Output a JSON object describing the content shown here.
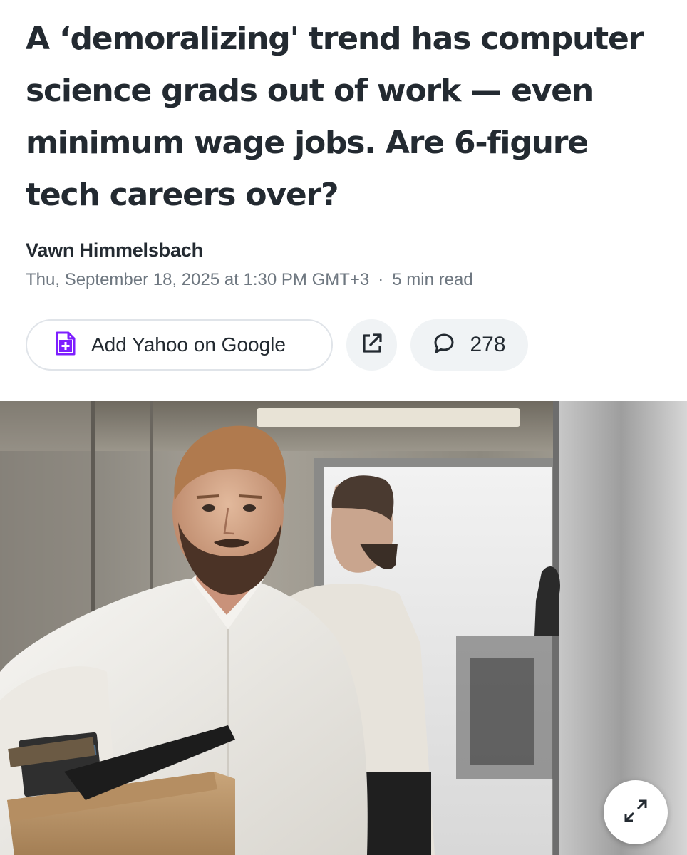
{
  "article": {
    "headline": "A ‘demoralizing' trend has computer science grads out of work — even minimum wage jobs. Are 6-figure tech careers over?",
    "author": "Vawn Himmelsbach",
    "date": "Thu, September 18, 2025 at 1:30 PM GMT+3",
    "separator": "·",
    "read_time": "5 min read"
  },
  "actions": {
    "add_google_label": "Add Yahoo on Google",
    "comment_count": "278"
  },
  "colors": {
    "text": "#232a31",
    "meta_text": "#6e7780",
    "accent_purple": "#7e1fff",
    "button_bg": "#f0f3f5"
  },
  "icons": {
    "add_google": "document-plus-icon",
    "share": "external-link-icon",
    "comments": "speech-bubble-icon",
    "expand": "expand-arrows-icon"
  },
  "image": {
    "description_icon": "photo"
  }
}
